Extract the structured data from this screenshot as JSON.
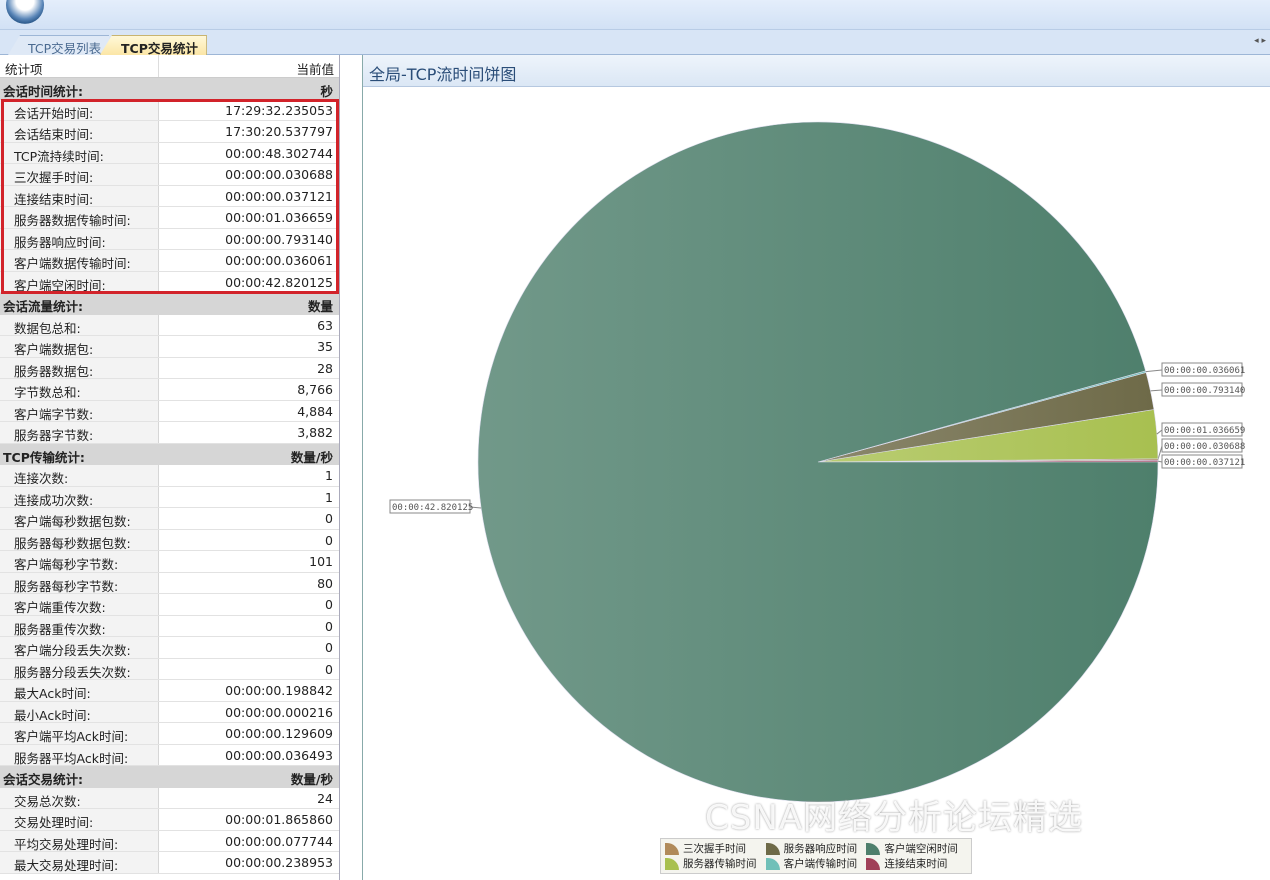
{
  "tabs": [
    {
      "label": "TCP交易列表"
    },
    {
      "label": "TCP交易统计"
    }
  ],
  "tab_nav": "◂ ▸",
  "table": {
    "col_item": "统计项",
    "col_value": "当前值",
    "groups": [
      {
        "name": "会话时间统计:",
        "unit": "秒",
        "rows": [
          [
            "会话开始时间:",
            "17:29:32.235053"
          ],
          [
            "会话结束时间:",
            "17:30:20.537797"
          ],
          [
            "TCP流持续时间:",
            "00:00:48.302744"
          ],
          [
            "三次握手时间:",
            "00:00:00.030688"
          ],
          [
            "连接结束时间:",
            "00:00:00.037121"
          ],
          [
            "服务器数据传输时间:",
            "00:00:01.036659"
          ],
          [
            "服务器响应时间:",
            "00:00:00.793140"
          ],
          [
            "客户端数据传输时间:",
            "00:00:00.036061"
          ],
          [
            "客户端空闲时间:",
            "00:00:42.820125"
          ]
        ]
      },
      {
        "name": "会话流量统计:",
        "unit": "数量",
        "rows": [
          [
            "数据包总和:",
            "63"
          ],
          [
            "客户端数据包:",
            "35"
          ],
          [
            "服务器数据包:",
            "28"
          ],
          [
            "字节数总和:",
            "8,766"
          ],
          [
            "客户端字节数:",
            "4,884"
          ],
          [
            "服务器字节数:",
            "3,882"
          ]
        ]
      },
      {
        "name": "TCP传输统计:",
        "unit": "数量/秒",
        "rows": [
          [
            "连接次数:",
            "1"
          ],
          [
            "连接成功次数:",
            "1"
          ],
          [
            "客户端每秒数据包数:",
            "0"
          ],
          [
            "服务器每秒数据包数:",
            "0"
          ],
          [
            "客户端每秒字节数:",
            "101"
          ],
          [
            "服务器每秒字节数:",
            "80"
          ],
          [
            "客户端重传次数:",
            "0"
          ],
          [
            "服务器重传次数:",
            "0"
          ],
          [
            "客户端分段丢失次数:",
            "0"
          ],
          [
            "服务器分段丢失次数:",
            "0"
          ],
          [
            "最大Ack时间:",
            "00:00:00.198842"
          ],
          [
            "最小Ack时间:",
            "00:00:00.000216"
          ],
          [
            "客户端平均Ack时间:",
            "00:00:00.129609"
          ],
          [
            "服务器平均Ack时间:",
            "00:00:00.036493"
          ]
        ]
      },
      {
        "name": "会话交易统计:",
        "unit": "数量/秒",
        "rows": [
          [
            "交易总次数:",
            "24"
          ],
          [
            "交易处理时间:",
            "00:00:01.865860"
          ],
          [
            "平均交易处理时间:",
            "00:00:00.077744"
          ],
          [
            "最大交易处理时间:",
            "00:00:00.238953"
          ]
        ]
      }
    ]
  },
  "chart_data": {
    "type": "pie",
    "title": "全局-TCP流时间饼图",
    "slices": [
      {
        "name": "连接结束时间",
        "value": 0.037121,
        "label": "00:00:00.037121",
        "color": "#a04058"
      },
      {
        "name": "三次握手时间",
        "value": 0.030688,
        "label": "00:00:00.030688",
        "color": "#b08a5a"
      },
      {
        "name": "服务器传输时间",
        "value": 1.036659,
        "label": "00:00:01.036659",
        "color": "#a8c050"
      },
      {
        "name": "服务器响应时间",
        "value": 0.79314,
        "label": "00:00:00.793140",
        "color": "#6e6a48"
      },
      {
        "name": "客户端传输时间",
        "value": 0.036061,
        "label": "00:00:00.036061",
        "color": "#70c0b8"
      },
      {
        "name": "客户端空闲时间",
        "value": 42.820125,
        "label": "00:00:42.820125",
        "color": "#4e7f6c"
      }
    ],
    "legend_order": [
      1,
      3,
      5,
      2,
      4,
      0
    ],
    "legend_position": "bottom"
  },
  "watermark": "CSNA网络分析论坛精选"
}
